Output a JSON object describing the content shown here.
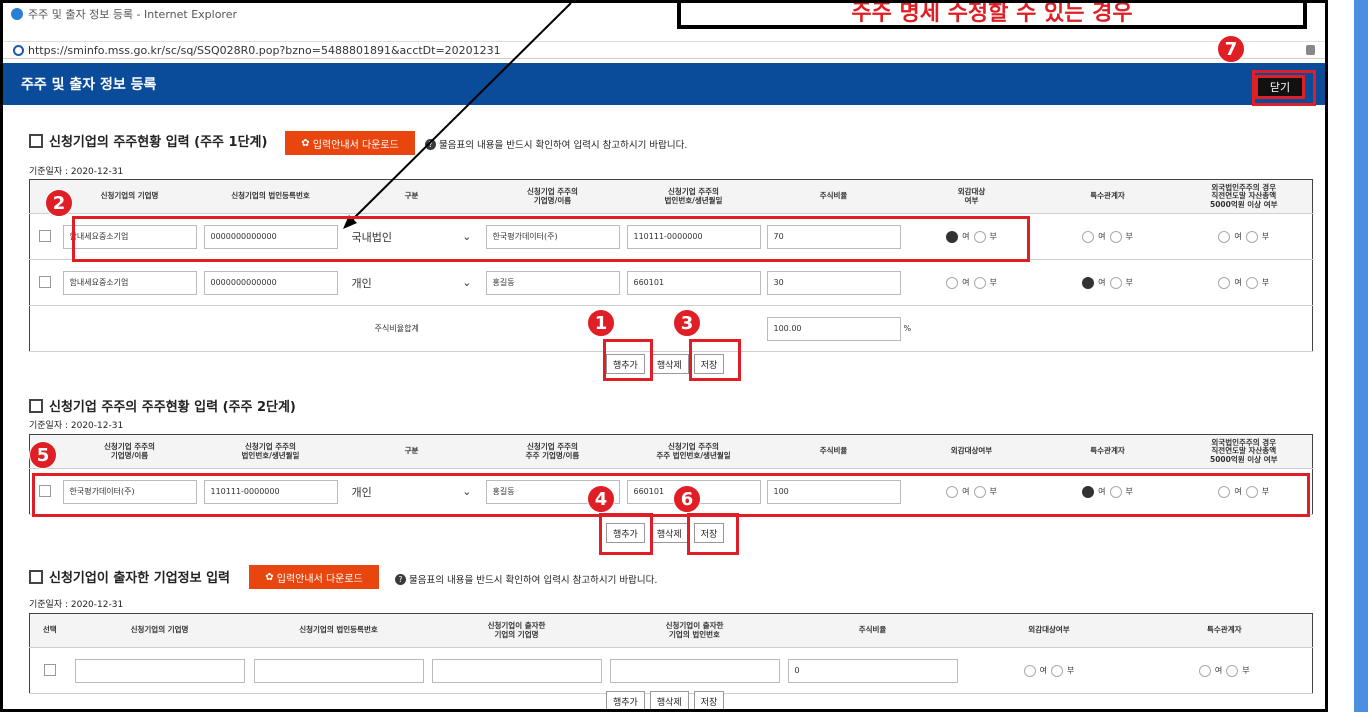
{
  "window": {
    "title": "주주 및 출자 정보 등록 - Internet Explorer",
    "url": "https://sminfo.mss.go.kr/sc/sq/SSQ028R0.pop?bzno=5488801891&acctDt=20201231"
  },
  "callout": "주주 명세 수정할 수 있는 경우",
  "header": {
    "title": "주주 및 출자 정보 등록",
    "close_label": "닫기"
  },
  "guide_btn": "입력안내서 다운로드",
  "help_text": "물음표의 내용을 반드시 확인하여 입력시 참고하시기 바랍니다.",
  "date": "기준일자 : 2020-12-31",
  "yes": "여",
  "no": "부",
  "section1": {
    "title": "신청기업의 주주현황 입력 (주주 1단계)",
    "headers": [
      "신청기업의 기업명",
      "신청기업의 법인등록번호",
      "구분",
      "신청기업 주주의\n기업명/이름",
      "신청기업 주주의\n법인번호/생년월일",
      "주식비율",
      "외감대상\n여부",
      "특수관계자",
      "외국법인주주의 경우\n직전연도말 자산총액\n5000억원 이상 여부"
    ],
    "rows": [
      {
        "company": "함내세요중소기업",
        "regno": "0000000000000",
        "type": "국내법인",
        "holder": "한국평가데이터(주)",
        "holder_no": "110111-0000000",
        "ratio": "70"
      },
      {
        "company": "함내세요중소기업",
        "regno": "0000000000000",
        "type": "개인",
        "holder": "홍길동",
        "holder_no": "660101",
        "ratio": "30"
      }
    ],
    "sum_label": "주식비율합계",
    "sum_value": "100.00",
    "sum_unit": "%"
  },
  "section2": {
    "title": "신청기업 주주의 주주현황 입력 (주주 2단계)",
    "headers": [
      "신청기업 주주의\n기업명/이름",
      "신청기업 주주의\n법인번호/생년월일",
      "구분",
      "신청기업 주주의\n주주 기업명/이름",
      "신청기업 주주의\n주주 법인번호/생년월일",
      "주식비율",
      "외감대상여부",
      "특수관계자",
      "외국법인주주의 경우\n직전연도말 자산총액\n5000억원 이상 여부"
    ],
    "row": {
      "company": "한국평가데이터(주)",
      "regno": "110111-0000000",
      "type": "개인",
      "holder": "홍길동",
      "holder_no": "660101",
      "ratio": "100"
    }
  },
  "section3": {
    "title": "신청기업이 출자한 기업정보 입력",
    "headers": [
      "선택",
      "신청기업의 기업명",
      "신청기업의 법인등록번호",
      "신청기업이 출자한\n기업의 기업명",
      "신청기업이 출자한\n기업의 법인번호",
      "주식비율",
      "외감대상여부",
      "특수관계자"
    ],
    "row": {
      "ratio": "0"
    }
  },
  "buttons": {
    "add": "행추가",
    "del": "행삭제",
    "save": "저장"
  },
  "badges": [
    "1",
    "2",
    "3",
    "4",
    "5",
    "6",
    "7"
  ]
}
